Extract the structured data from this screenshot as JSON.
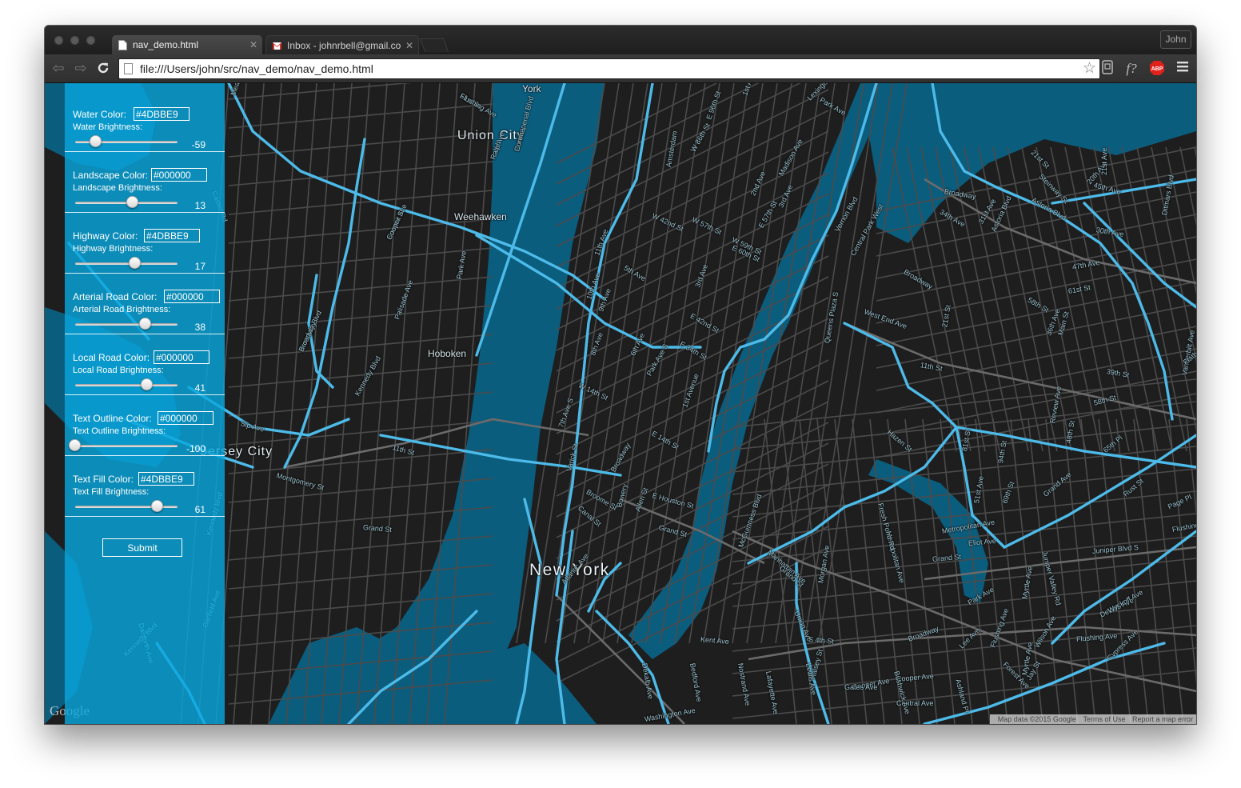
{
  "browser": {
    "tabs": [
      {
        "title": "nav_demo.html",
        "active": true,
        "icon": "page-icon"
      },
      {
        "title": "Inbox - johnrbell@gmail.co",
        "active": false,
        "icon": "gmail-icon"
      }
    ],
    "profile_name": "John",
    "url": "file:///Users/john/src/nav_demo/nav_demo.html",
    "extensions": [
      "reader-icon",
      "f-question-icon",
      "adblock-plus-icon",
      "menu-icon"
    ]
  },
  "panel": {
    "sections": [
      {
        "color_label": "Water Color:",
        "color_value": "#4DBBE9",
        "brightness_label": "Water Brightness:",
        "brightness_value": "-59",
        "brightness": -59
      },
      {
        "color_label": "Landscape Color:",
        "color_value": "#000000",
        "brightness_label": "Landscape Brightness:",
        "brightness_value": "13",
        "brightness": 13
      },
      {
        "color_label": "Highway Color:",
        "color_value": "#4DBBE9",
        "brightness_label": "Highway Brightness:",
        "brightness_value": "17",
        "brightness": 17
      },
      {
        "color_label": "Arterial Road Color:",
        "color_value": "#000000",
        "brightness_label": "Arterial Road Brightness:",
        "brightness_value": "38",
        "brightness": 38
      },
      {
        "color_label": "Local Road Color:",
        "color_value": "#000000",
        "brightness_label": "Local Road Brightness:",
        "brightness_value": "41",
        "brightness": 41
      },
      {
        "color_label": "Text Outline Color:",
        "color_value": "#000000",
        "brightness_label": "Text Outline Brightness:",
        "brightness_value": "-100",
        "brightness": -100
      },
      {
        "color_label": "Text Fill Color:",
        "color_value": "#4DBBE9",
        "brightness_label": "Text Fill Brightness:",
        "brightness_value": "61",
        "brightness": 61
      }
    ],
    "submit_label": "Submit"
  },
  "map": {
    "colors": {
      "water": "#0b5d7e",
      "land": "#1e1e1e",
      "highway": "#4dbbe9",
      "road": "#5a5a5a"
    },
    "labels": {
      "cities": [
        {
          "text": "New York",
          "style": "big"
        },
        {
          "text": "Union City",
          "style": "city"
        },
        {
          "text": "Jersey City",
          "style": "city"
        }
      ],
      "places": [
        "Weehawken",
        "Hoboken",
        "York"
      ],
      "streets": [
        "51st St",
        "Park Ave",
        "Port Imperial Blvd",
        "Summit Ave",
        "Kennedy Blvd",
        "Palisade Ave",
        "Park Ave",
        "Kennedy Blvd",
        "11th St",
        "Sip Ave",
        "Montgomery St",
        "Grand St",
        "Kennedy Blvd",
        "Garfield Ave",
        "Danforth Ave",
        "Kennedy Blvd",
        "Meadowlands",
        "Caster Rd",
        "11th Ave",
        "10th Ave",
        "9th Ave",
        "8th Ave",
        "6th Ave",
        "W 14th St",
        "7th Ave S",
        "Varick St",
        "Broadway",
        "Broome St",
        "Canal St",
        "Bowery",
        "Allen St",
        "E Houston St",
        "Grand St",
        "Park Ave S",
        "1st Avenue",
        "E 14th St",
        "E 34th St",
        "E 42nd St",
        "3rd Ave",
        "5th Ave",
        "W 42nd St",
        "W 57th St",
        "W 59th St",
        "E 60th St",
        "E 57th St",
        "2nd Ave",
        "3rd Ave",
        "Madison Ave",
        "Lexington Ave",
        "Park Ave",
        "1st Avenue",
        "E 96th St",
        "W 86th St",
        "Amsterdam",
        "Central Park West",
        "West End Ave",
        "Broadway",
        "Vernon Blvd",
        "Queens Plaza S",
        "21st St",
        "36th Ave",
        "Main St",
        "11th St",
        "39th St",
        "58th St",
        "61st St",
        "47th Ave",
        "45th Ave",
        "Broadway",
        "34th Ave",
        "31st Ave",
        "Astoria Blvd",
        "30th Ave",
        "21st St",
        "Steinway St",
        "Astoria Blvd",
        "20th Ave",
        "21st Ave",
        "Ditmars Blvd",
        "Hazen St",
        "81st St",
        "94th St",
        "Review Ave",
        "48th St",
        "58th St",
        "65th Pl",
        "69th St",
        "51st Ave",
        "Grand Ave",
        "Rust St",
        "Page Pl",
        "Flushing Ave",
        "Eliot Ave",
        "Juniper Blvd S",
        "Juniper Valley Rd",
        "Metropolitan Ave",
        "Metropolitan Ave",
        "Fresh Pond Rd",
        "Grand St",
        "Morgan Ave",
        "McGuinness Blvd",
        "Manhattan Ave",
        "Grand St",
        "Union Ave",
        "Kent Ave",
        "S 4th St",
        "Broadway",
        "Lee Ave",
        "Flushing Ave",
        "Park Ave",
        "Myrtle Ave",
        "Wilson Ave",
        "Flushing Ave",
        "Dekalb Ave",
        "Wyckoff Ave",
        "Cypress Ave",
        "Myrtle Ave",
        "Forest Ave",
        "Central Ave",
        "Cooper Ave",
        "Cooper Ave",
        "Bushwick Ave",
        "Halsey St",
        "Gates Ave",
        "Lafayette Ave",
        "Lewis Ave",
        "Nostrand Ave",
        "Bedford Ave",
        "Dekalb Ave",
        "Washington Ave",
        "Vanderbilt Ave",
        "Flatbush Ave Ext",
        "Jay St",
        "Ashland Pl",
        "Atlantic Ave",
        "Flushing Ave",
        "Ralph",
        "Corona",
        "Cooper St",
        "Broadway"
      ]
    },
    "attribution": {
      "data": "Map data ©2015 Google",
      "terms": "Terms of Use",
      "report": "Report a map error"
    },
    "logo": "Google"
  }
}
